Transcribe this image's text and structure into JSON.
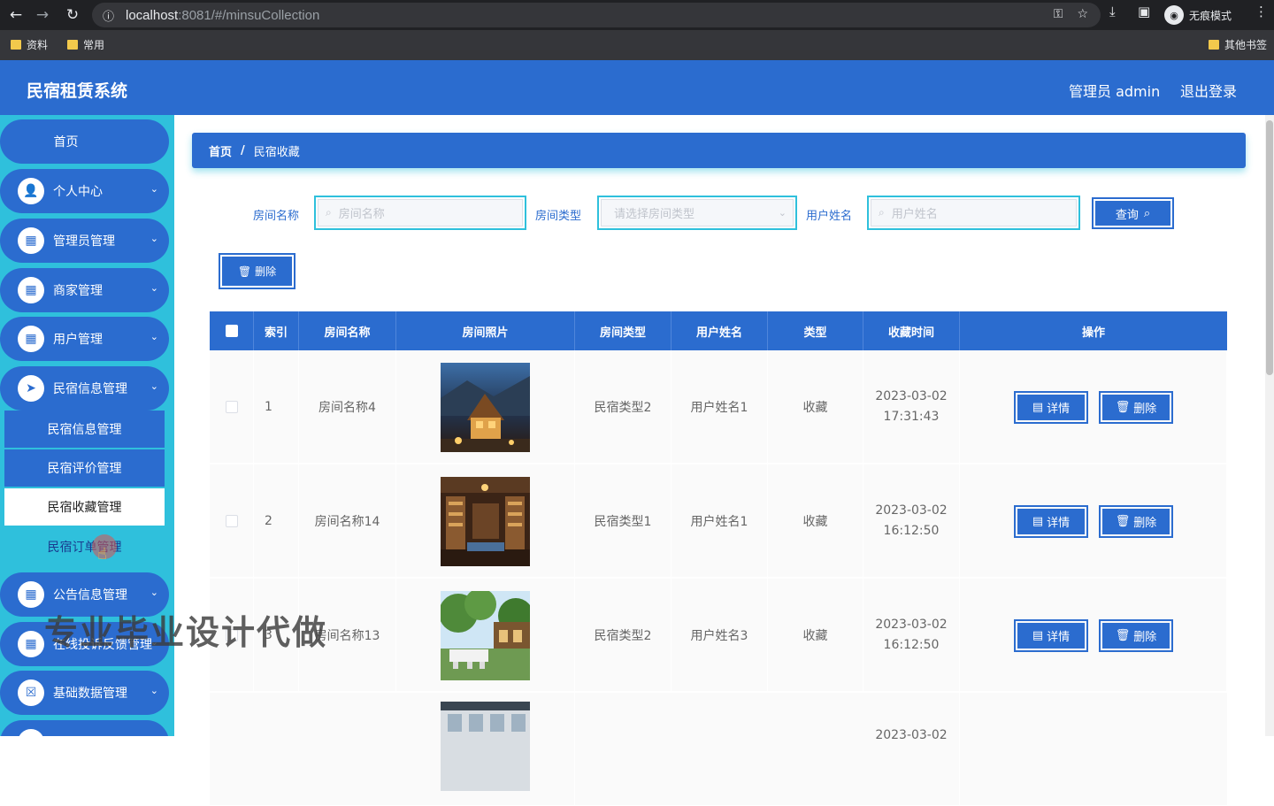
{
  "browser": {
    "url_host": "localhost",
    "url_rest": ":8081/#/minsuCollection",
    "incognito_label": "无痕模式",
    "bookmarks": [
      "资料",
      "常用"
    ],
    "other_bookmarks": "其他书签"
  },
  "header": {
    "title": "民宿租赁系统",
    "user": "管理员 admin",
    "logout": "退出登录"
  },
  "sidebar": {
    "items": [
      {
        "label": "首页"
      },
      {
        "label": "个人中心",
        "icon": "user-icon"
      },
      {
        "label": "管理员管理",
        "icon": "grid-icon"
      },
      {
        "label": "商家管理",
        "icon": "grid-icon"
      },
      {
        "label": "用户管理",
        "icon": "grid-icon"
      },
      {
        "label": "民宿信息管理",
        "icon": "send-icon"
      }
    ],
    "sub_items": [
      {
        "label": "民宿信息管理"
      },
      {
        "label": "民宿评价管理"
      },
      {
        "label": "民宿收藏管理"
      },
      {
        "label": "民宿订单管理"
      }
    ],
    "items_after": [
      {
        "label": "公告信息管理",
        "icon": "grid-icon"
      },
      {
        "label": "在线投诉反馈管理",
        "icon": "grid-icon"
      },
      {
        "label": "基础数据管理",
        "icon": "clipboard-icon"
      }
    ]
  },
  "breadcrumb": {
    "home": "首页",
    "separator": "/",
    "current": "民宿收藏"
  },
  "search": {
    "room_name_label": "房间名称",
    "room_name_placeholder": "房间名称",
    "room_type_label": "房间类型",
    "room_type_placeholder": "请选择房间类型",
    "user_name_label": "用户姓名",
    "user_name_placeholder": "用户姓名",
    "query_button": "查询"
  },
  "toolbar": {
    "delete_button": "删除"
  },
  "table": {
    "headers": [
      "索引",
      "房间名称",
      "房间照片",
      "房间类型",
      "用户姓名",
      "类型",
      "收藏时间",
      "操作"
    ],
    "rows": [
      {
        "index": "1",
        "room_name": "房间名称4",
        "room_type": "民宿类型2",
        "user_name": "用户姓名1",
        "type": "收藏",
        "date": "2023-03-02",
        "time": "17:31:43"
      },
      {
        "index": "2",
        "room_name": "房间名称14",
        "room_type": "民宿类型1",
        "user_name": "用户姓名1",
        "type": "收藏",
        "date": "2023-03-02",
        "time": "16:12:50"
      },
      {
        "index": "3",
        "room_name": "房间名称13",
        "room_type": "民宿类型2",
        "user_name": "用户姓名3",
        "type": "收藏",
        "date": "2023-03-02",
        "time": "16:12:50"
      },
      {
        "index": "",
        "room_name": "",
        "room_type": "",
        "user_name": "",
        "type": "",
        "date": "2023-03-02",
        "time": ""
      }
    ],
    "detail_button": "详情",
    "delete_button": "删除"
  },
  "watermark": "专业毕业设计代做",
  "colors": {
    "primary": "#2b6ccf",
    "sidebar_bg": "#2fc0dc"
  }
}
